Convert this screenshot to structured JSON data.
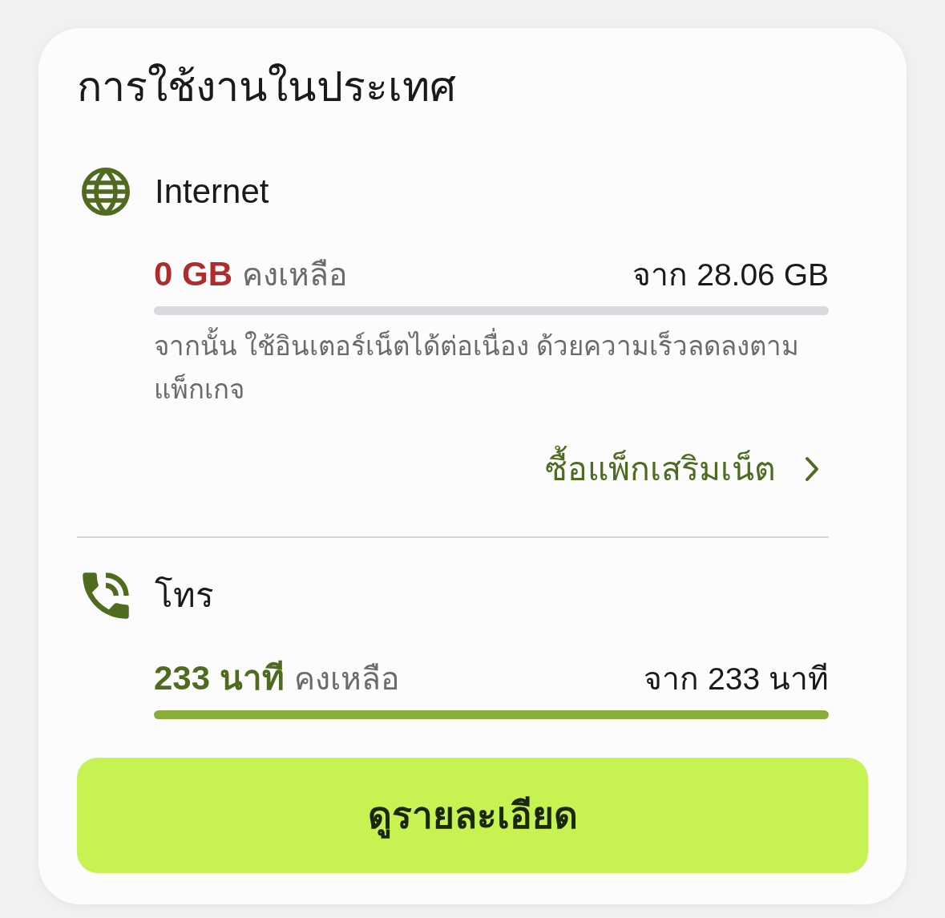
{
  "card": {
    "title": "การใช้งานในประเทศ"
  },
  "sections": [
    {
      "kind": "internet",
      "label": "Internet",
      "remaining": "0 GB",
      "remaining_label": "คงเหลือ",
      "color": "#b02c2c",
      "total": "จาก 28.06 GB",
      "level": 0,
      "note": "จากนั้น ใช้อินเตอร์เน็ตได้ต่อเนื่อง ด้วยความเร็วลดลงตามแพ็กเกจ",
      "link": "ซื้อแพ็กเสริมเน็ต"
    },
    {
      "kind": "call",
      "label": "โทร",
      "remaining": "233 นาที",
      "remaining_label": "คงเหลือ",
      "color": "#4e6b1f",
      "total": "จาก 233 นาที",
      "level": 1
    }
  ],
  "button": {
    "label": "ดูรายละเอียด"
  }
}
